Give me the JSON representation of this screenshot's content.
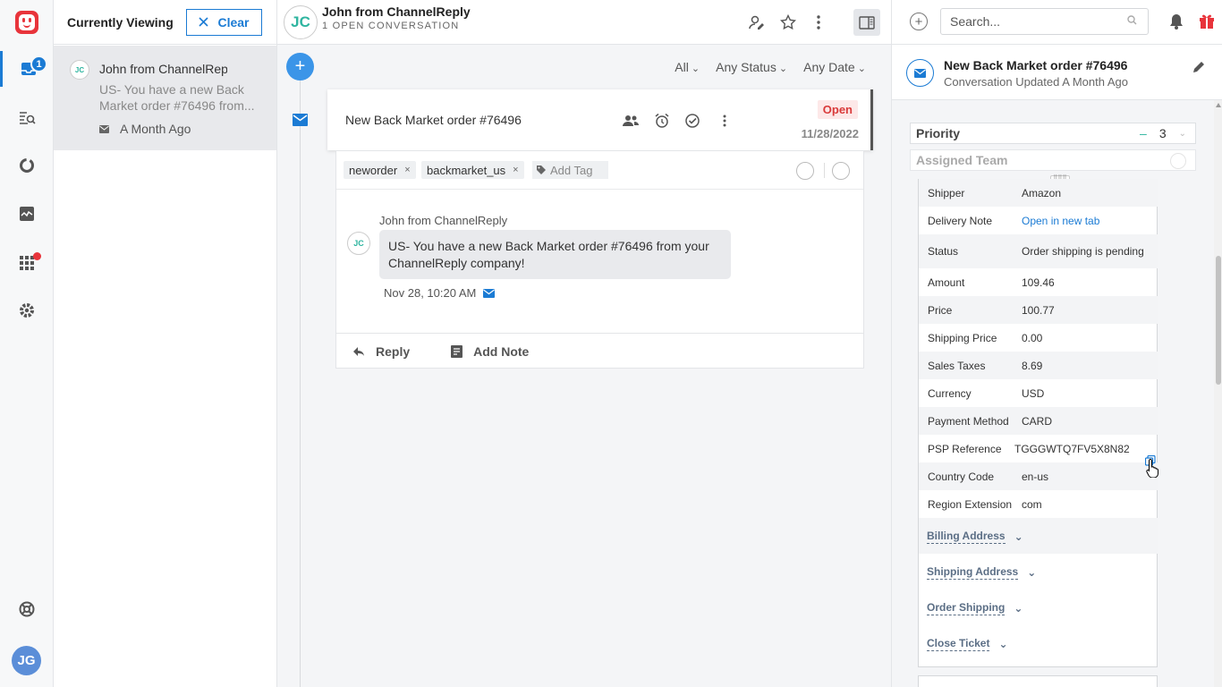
{
  "rail": {
    "inbox_badge": "1",
    "user_initials": "JG"
  },
  "list": {
    "title": "Currently Viewing",
    "clear_label": "Clear",
    "item": {
      "initials": "JC",
      "name": "John from ChannelReply",
      "preview": "US- You have a new Back Market order #76496 from...",
      "time": "A Month Ago"
    }
  },
  "main": {
    "header": {
      "initials": "JC",
      "name": "John from ChannelReply",
      "subtitle": "1 OPEN CONVERSATION"
    },
    "filters": [
      "All",
      "Any Status",
      "Any Date"
    ],
    "card": {
      "subject": "New Back Market order #76496",
      "status": "Open",
      "date": "11/28/2022"
    },
    "tags": [
      "neworder",
      "backmarket_us"
    ],
    "add_tag_placeholder": "Add Tag",
    "message": {
      "author": "John from ChannelReply",
      "initials": "JC",
      "body": "US- You have a new Back Market order #76496 from your ChannelReply company!",
      "time": "Nov 28, 10:20 AM"
    },
    "actions": {
      "reply": "Reply",
      "add_note": "Add Note"
    }
  },
  "right": {
    "search_placeholder": "Search...",
    "conversation": {
      "title": "New Back Market order #76496",
      "subtitle": "Conversation Updated A Month Ago"
    },
    "priority": {
      "label": "Priority",
      "value": "3"
    },
    "assigned_team": {
      "label": "Assigned Team"
    },
    "order_fields": [
      {
        "key": "Shipper",
        "value": "Amazon"
      },
      {
        "key": "Delivery Note",
        "value": "Open in new tab"
      },
      {
        "key": "Status",
        "value": "Order shipping is pending"
      },
      {
        "key": "Amount",
        "value": "109.46"
      },
      {
        "key": "Price",
        "value": "100.77"
      },
      {
        "key": "Shipping Price",
        "value": "0.00"
      },
      {
        "key": "Sales Taxes",
        "value": "8.69"
      },
      {
        "key": "Currency",
        "value": "USD"
      },
      {
        "key": "Payment Method",
        "value": "CARD"
      },
      {
        "key": "PSP Reference",
        "value": "TGGGWTQ7FV5X8N82"
      },
      {
        "key": "Country Code",
        "value": "en-us"
      },
      {
        "key": "Region Extension",
        "value": "com"
      }
    ],
    "sections": [
      "Billing Address",
      "Shipping Address",
      "Order Shipping",
      "Close Ticket"
    ]
  }
}
